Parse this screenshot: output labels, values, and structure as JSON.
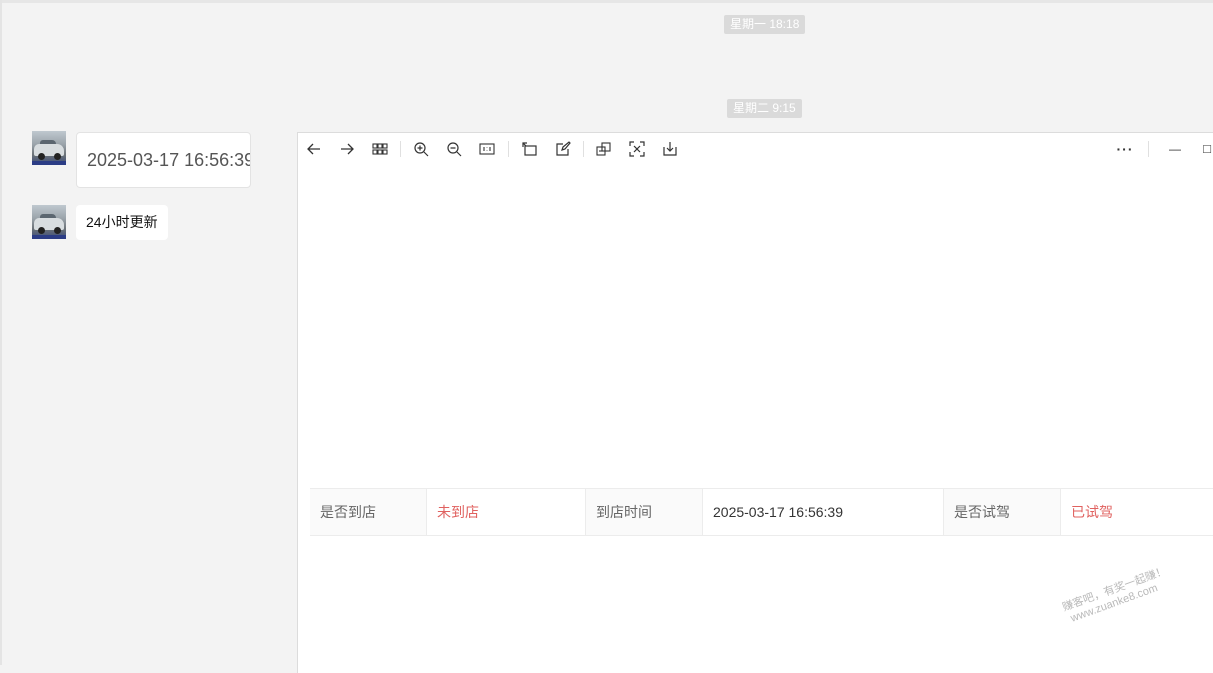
{
  "timestamps": [
    "星期一 18:18",
    "星期二 9:15"
  ],
  "messages": [
    {
      "type": "image-preview",
      "text": "2025-03-17 16:56:39"
    },
    {
      "type": "text",
      "text": "24小时更新"
    }
  ],
  "viewer": {
    "toolbar": [
      {
        "name": "back",
        "icon": "arrow-left-icon"
      },
      {
        "name": "forward",
        "icon": "arrow-right-icon"
      },
      {
        "name": "grid",
        "icon": "grid-icon"
      },
      {
        "name": "zoom-in",
        "icon": "zoom-in-icon"
      },
      {
        "name": "zoom-out",
        "icon": "zoom-out-icon"
      },
      {
        "name": "actual-size",
        "icon": "actual-size-icon",
        "label": "1:1"
      },
      {
        "name": "rotate",
        "icon": "rotate-icon"
      },
      {
        "name": "edit",
        "icon": "edit-icon"
      },
      {
        "name": "extract-text",
        "icon": "extract-icon"
      },
      {
        "name": "scan",
        "icon": "scan-icon"
      },
      {
        "name": "download",
        "icon": "download-icon"
      },
      {
        "name": "more",
        "icon": "more-icon",
        "label": "···"
      },
      {
        "name": "minimize",
        "icon": "minimize-icon",
        "label": "—"
      },
      {
        "name": "maximize",
        "icon": "maximize-icon",
        "label": "□"
      }
    ],
    "table": {
      "arrived_label": "是否到店",
      "arrived_value": "未到店",
      "arrival_time_label": "到店时间",
      "arrival_time_value": "2025-03-17 16:56:39",
      "test_drive_label": "是否试驾",
      "test_drive_value": "已试驾"
    }
  },
  "watermark": [
    "赚客吧，有奖一起赚！",
    "www.zuanke8.com"
  ],
  "colors": {
    "accent_red": "#e0615f",
    "background": "#f3f3f3"
  }
}
